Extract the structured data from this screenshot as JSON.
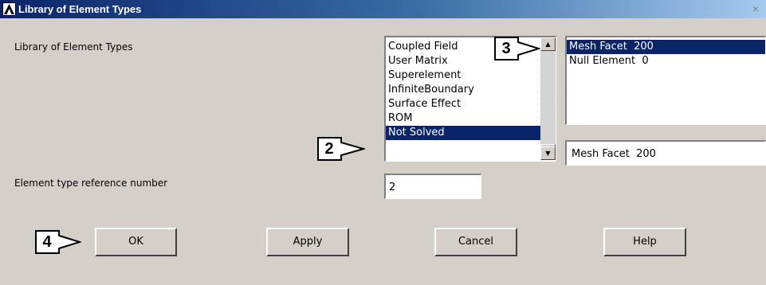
{
  "window": {
    "title": "Library of Element Types",
    "close_glyph": "×"
  },
  "form": {
    "library_label": "Library of Element Types",
    "ref_label": "Element type reference number",
    "ref_value": "2"
  },
  "category_list": {
    "items": [
      "Coupled Field",
      "User Matrix",
      "Superelement",
      "InfiniteBoundary",
      "Surface Effect",
      "ROM",
      "Not Solved"
    ],
    "selected": "Not Solved"
  },
  "element_list": {
    "items": [
      "Mesh Facet  200",
      "Null Element  0"
    ],
    "selected": "Mesh Facet  200",
    "current_value": "Mesh Facet  200"
  },
  "buttons": {
    "ok": "OK",
    "apply": "Apply",
    "cancel": "Cancel",
    "help": "Help"
  },
  "callouts": {
    "c2": "2",
    "c3": "3",
    "c4": "4"
  },
  "colors": {
    "selection": "#0a246a",
    "dialog_bg": "#d4d0c8",
    "titlebar": "#0a246a"
  }
}
